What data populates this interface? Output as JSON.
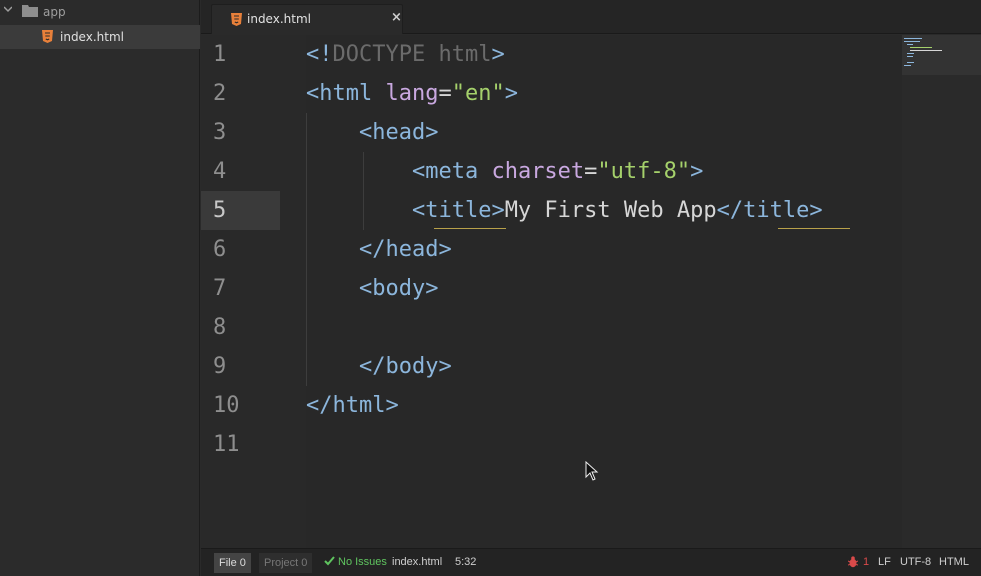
{
  "sidebar": {
    "folder": {
      "label": "app",
      "icon": "folder-icon"
    },
    "file": {
      "label": "index.html",
      "icon": "html5-icon"
    }
  },
  "tabs": [
    {
      "label": "index.html",
      "close": "×"
    }
  ],
  "editor": {
    "active_line": 5,
    "line_numbers": [
      "1",
      "2",
      "3",
      "4",
      "5",
      "6",
      "7",
      "8",
      "9",
      "10",
      "11"
    ],
    "lines": [
      [
        [
          "p",
          "<!"
        ],
        [
          "d",
          "DOCTYPE html"
        ],
        [
          "p",
          ">"
        ]
      ],
      [
        [
          "p",
          "<html "
        ],
        [
          "a",
          "lang"
        ],
        [
          "x",
          "="
        ],
        [
          "s",
          "\"en\""
        ],
        [
          "p",
          ">"
        ]
      ],
      [
        [
          "x",
          "    "
        ],
        [
          "p",
          "<head>"
        ]
      ],
      [
        [
          "x",
          "        "
        ],
        [
          "p",
          "<meta "
        ],
        [
          "a",
          "charset"
        ],
        [
          "x",
          "="
        ],
        [
          "s",
          "\"utf-8\""
        ],
        [
          "p",
          ">"
        ]
      ],
      [
        [
          "x",
          "        "
        ],
        [
          "p",
          "<title>"
        ],
        [
          "x",
          "My First Web App"
        ],
        [
          "p",
          "</title>"
        ]
      ],
      [
        [
          "x",
          "    "
        ],
        [
          "p",
          "</head>"
        ]
      ],
      [
        [
          "x",
          "    "
        ],
        [
          "p",
          "<body>"
        ]
      ],
      [],
      [
        [
          "x",
          "    "
        ],
        [
          "p",
          "</body>"
        ]
      ],
      [
        [
          "p",
          "</html>"
        ]
      ],
      []
    ]
  },
  "statusbar": {
    "file_tab": "File 0",
    "project_tab": "Project 0",
    "issues": "No Issues",
    "filename": "index.html",
    "cursor_position": "5:32",
    "bug_count": "1",
    "line_ending": "LF",
    "encoding": "UTF-8",
    "grammar": "HTML"
  },
  "colors": {
    "tag": "#8cb6dc",
    "attribute": "#c9a8e0",
    "string": "#a5d16b",
    "doctype": "#6b6b6b",
    "ok": "#5fc45f",
    "error": "#d94a4a",
    "html5_icon": "#e8803a"
  }
}
